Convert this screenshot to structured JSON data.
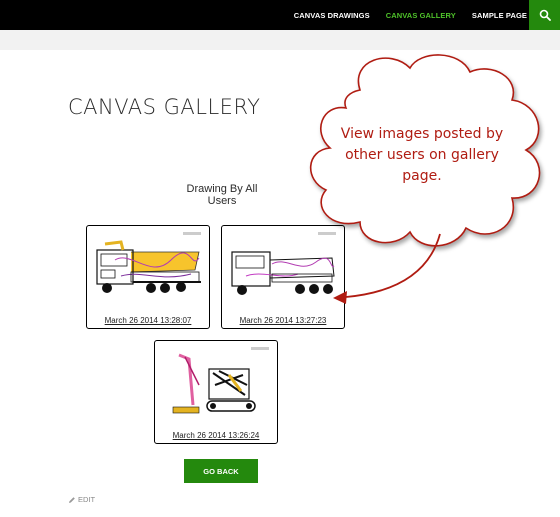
{
  "nav": {
    "items": [
      {
        "label": "CANVAS DRAWINGS",
        "active": false
      },
      {
        "label": "CANVAS GALLERY",
        "active": true
      },
      {
        "label": "SAMPLE PAGE",
        "active": false
      }
    ],
    "search_icon": "search-icon"
  },
  "colors": {
    "topbar": "#000000",
    "accent": "#24890d",
    "active_nav": "#4fc12a",
    "callout_text": "#b01c12"
  },
  "page": {
    "title": "CANVAS GALLERY",
    "section_label": "Drawing By All Users"
  },
  "gallery": [
    {
      "caption": "March 26 2014 13:28:07",
      "subject": "dump truck drawing"
    },
    {
      "caption": "March 26 2014 13:27:23",
      "subject": "dump truck drawing"
    },
    {
      "caption": "March 26 2014 13:26:24",
      "subject": "excavator drawing"
    }
  ],
  "go_back_label": "GO BACK",
  "edit_label": "EDIT",
  "callout": {
    "text": "View images posted by other users on gallery page."
  }
}
